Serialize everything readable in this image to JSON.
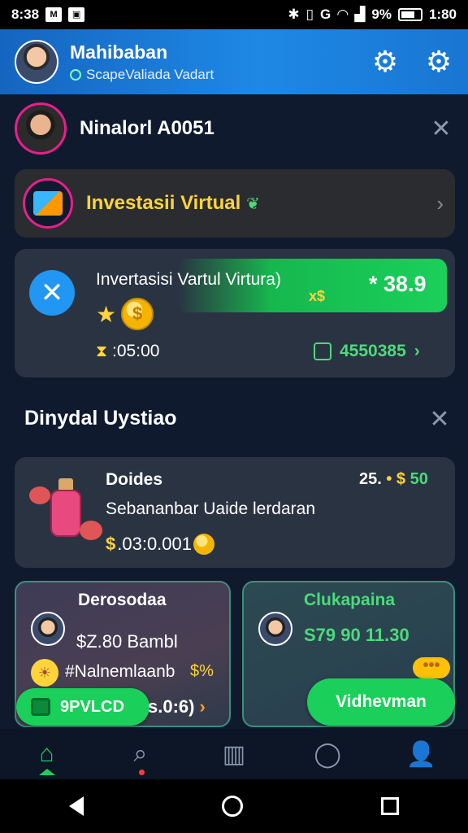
{
  "status_bar": {
    "left_text": "8:38",
    "time": "1:80",
    "battery": "9%"
  },
  "header": {
    "name": "Mahibaban",
    "subtitle": "ScapeValiada Vadart"
  },
  "profile": {
    "name": "Ninalorl A0051"
  },
  "invest_card": {
    "title": "Investasii Virtual"
  },
  "balance_card": {
    "title": "Invertasisi Vartul  Virtura)",
    "badge": "x$",
    "amount": "* 38.9",
    "time": ":05:00",
    "right_value": "4550385"
  },
  "section2": {
    "title": "Dinydal Uystiao"
  },
  "product": {
    "name": "Doides",
    "stats_white": "25.",
    "stats_gold": "• $",
    "stats_green": "50",
    "description": "Sebananbar Uaide lerdaran",
    "price_symbol": "$",
    "price": ".03:0.001"
  },
  "card_left": {
    "title": "Derosodaa",
    "amount": "$Z.80 Bambl",
    "subtitle": "#Nalnemlaanb",
    "badge": "$%",
    "pill_label": "9PVLCD",
    "extra": "s.0:6)"
  },
  "card_right": {
    "title": "Clukapaina",
    "amount": "S79 90 11.30",
    "button_label": "Vidhevman"
  },
  "colors": {
    "accent_green": "#1ad05a",
    "header_blue": "#1e88e5",
    "gold": "#ffd43b",
    "pink": "#e91e8c"
  },
  "icons": {
    "header_right": [
      "gear-icon",
      "gear-icon"
    ],
    "bottom_nav": [
      "home-icon",
      "search-icon",
      "store-icon",
      "chat-icon",
      "profile-icon"
    ]
  }
}
